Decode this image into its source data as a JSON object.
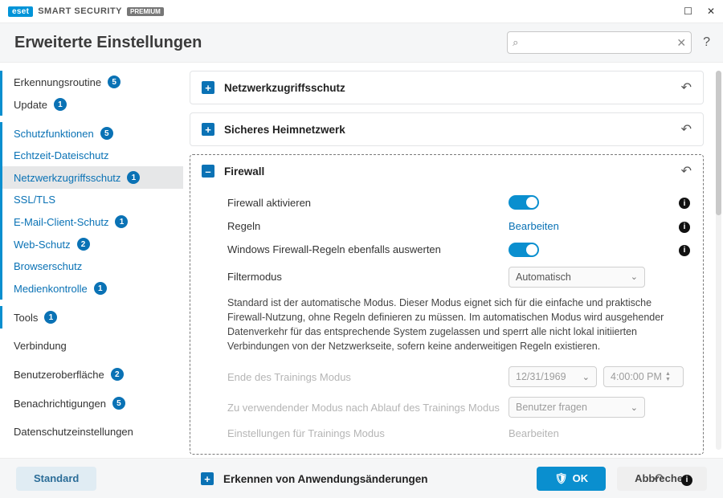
{
  "titlebar": {
    "logo": "eset",
    "product": "SMART SECURITY",
    "edition": "PREMIUM"
  },
  "header": {
    "title": "Erweiterte Einstellungen",
    "search_placeholder": ""
  },
  "sidebar": {
    "items": [
      {
        "label": "Erkennungsroutine",
        "badge": "5",
        "kind": "top"
      },
      {
        "label": "Update",
        "badge": "1",
        "kind": "top"
      },
      {
        "label": "Schutzfunktionen",
        "badge": "5",
        "kind": "top",
        "color": "link"
      },
      {
        "label": "Echtzeit-Dateischutz",
        "kind": "sub"
      },
      {
        "label": "Netzwerkzugriffsschutz",
        "badge": "1",
        "kind": "sub",
        "selected": true
      },
      {
        "label": "SSL/TLS",
        "kind": "sub"
      },
      {
        "label": "E-Mail-Client-Schutz",
        "badge": "1",
        "kind": "sub"
      },
      {
        "label": "Web-Schutz",
        "badge": "2",
        "kind": "sub"
      },
      {
        "label": "Browserschutz",
        "kind": "sub"
      },
      {
        "label": "Medienkontrolle",
        "badge": "1",
        "kind": "sub"
      },
      {
        "label": "Tools",
        "badge": "1",
        "kind": "top"
      },
      {
        "label": "Verbindung",
        "kind": "top"
      },
      {
        "label": "Benutzeroberfläche",
        "badge": "2",
        "kind": "top"
      },
      {
        "label": "Benachrichtigungen",
        "badge": "5",
        "kind": "top"
      },
      {
        "label": "Datenschutzeinstellungen",
        "kind": "top"
      }
    ]
  },
  "sections": {
    "net_protection": {
      "title": "Netzwerkzugriffsschutz"
    },
    "home_net": {
      "title": "Sicheres Heimnetzwerk"
    },
    "firewall": {
      "title": "Firewall",
      "rows": {
        "enable": {
          "label": "Firewall aktivieren"
        },
        "rules": {
          "label": "Regeln",
          "action": "Bearbeiten"
        },
        "win_rules": {
          "label": "Windows Firewall-Regeln ebenfalls auswerten"
        },
        "filter_mode": {
          "label": "Filtermodus",
          "value": "Automatisch"
        }
      },
      "description": "Standard ist der automatische Modus. Dieser Modus eignet sich für die einfache und praktische Firewall-Nutzung, ohne Regeln definieren zu müssen. Im automatischen Modus wird ausgehender Datenverkehr für das entsprechende System zugelassen und sperrt alle nicht lokal initiierten Verbindungen von der Netzwerkseite, sofern keine anderweitigen Regeln existieren.",
      "disabled_rows": {
        "train_end": {
          "label": "Ende des Trainings Modus",
          "date": "12/31/1969",
          "time": "4:00:00 PM"
        },
        "post_train_mode": {
          "label": "Zu verwendender Modus nach Ablauf des Trainings Modus",
          "value": "Benutzer fragen"
        },
        "train_settings": {
          "label": "Einstellungen für Trainings Modus",
          "action": "Bearbeiten"
        }
      },
      "sub": {
        "title": "Erkennen von Anwendungsänderungen"
      }
    }
  },
  "footer": {
    "default": "Standard",
    "ok": "OK",
    "cancel": "Abbrechen"
  }
}
